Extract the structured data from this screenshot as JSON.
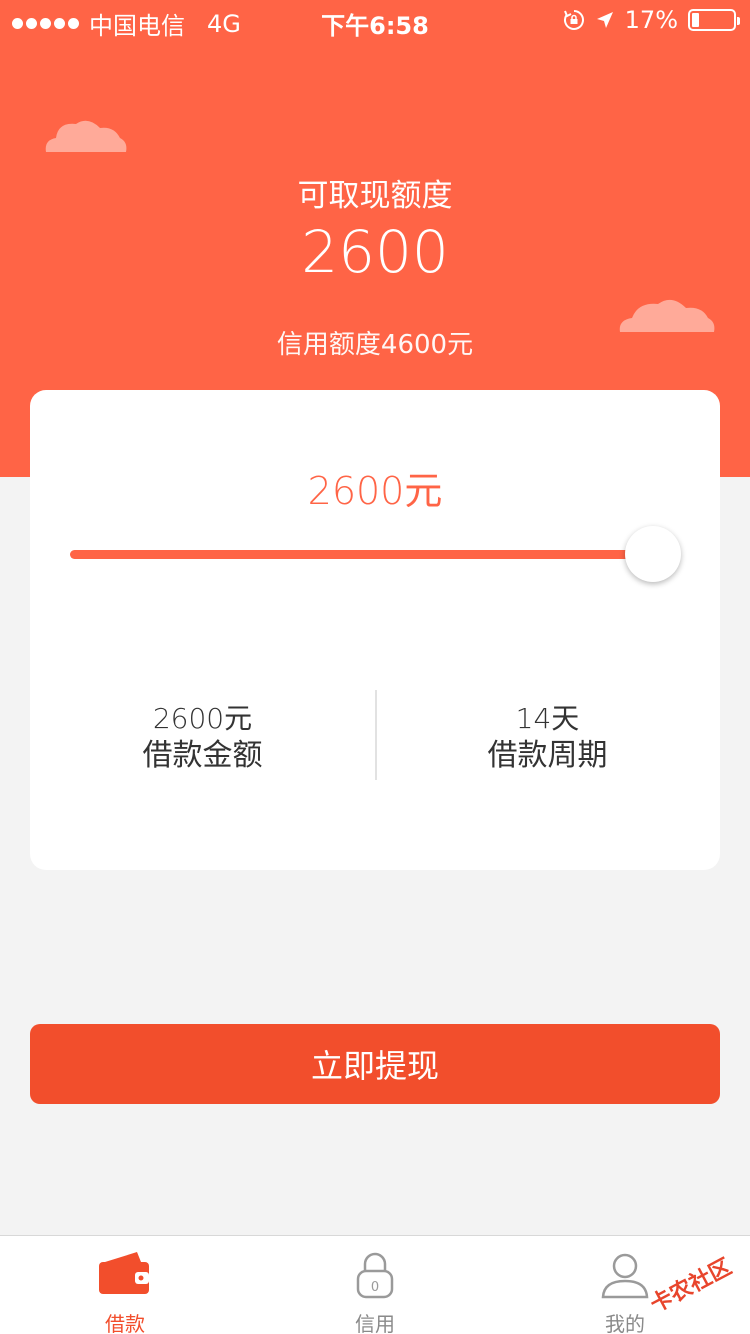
{
  "status_bar": {
    "carrier": "中国电信",
    "network": "4G",
    "time": "下午6:58",
    "battery": "17%",
    "battery_level": 0.17
  },
  "header": {
    "label": "可取现额度",
    "amount": "2600",
    "credit_limit": "信用额度4600元"
  },
  "loan_card": {
    "selected_amount": "2600元",
    "slider_fraction": 1.0,
    "amount_value": "2600元",
    "amount_label": "借款金额",
    "period_value": "14天",
    "period_label": "借款周期"
  },
  "actions": {
    "withdraw_label": "立即提现"
  },
  "tabs": [
    {
      "label": "借款",
      "icon": "wallet-icon",
      "active": true
    },
    {
      "label": "信用",
      "icon": "lock-icon",
      "active": false
    },
    {
      "label": "我的",
      "icon": "user-icon",
      "active": false
    }
  ],
  "watermark": "卡农社区",
  "colors": {
    "accent": "#ff6446",
    "button": "#f24e2c",
    "background": "#f3f3f3"
  }
}
